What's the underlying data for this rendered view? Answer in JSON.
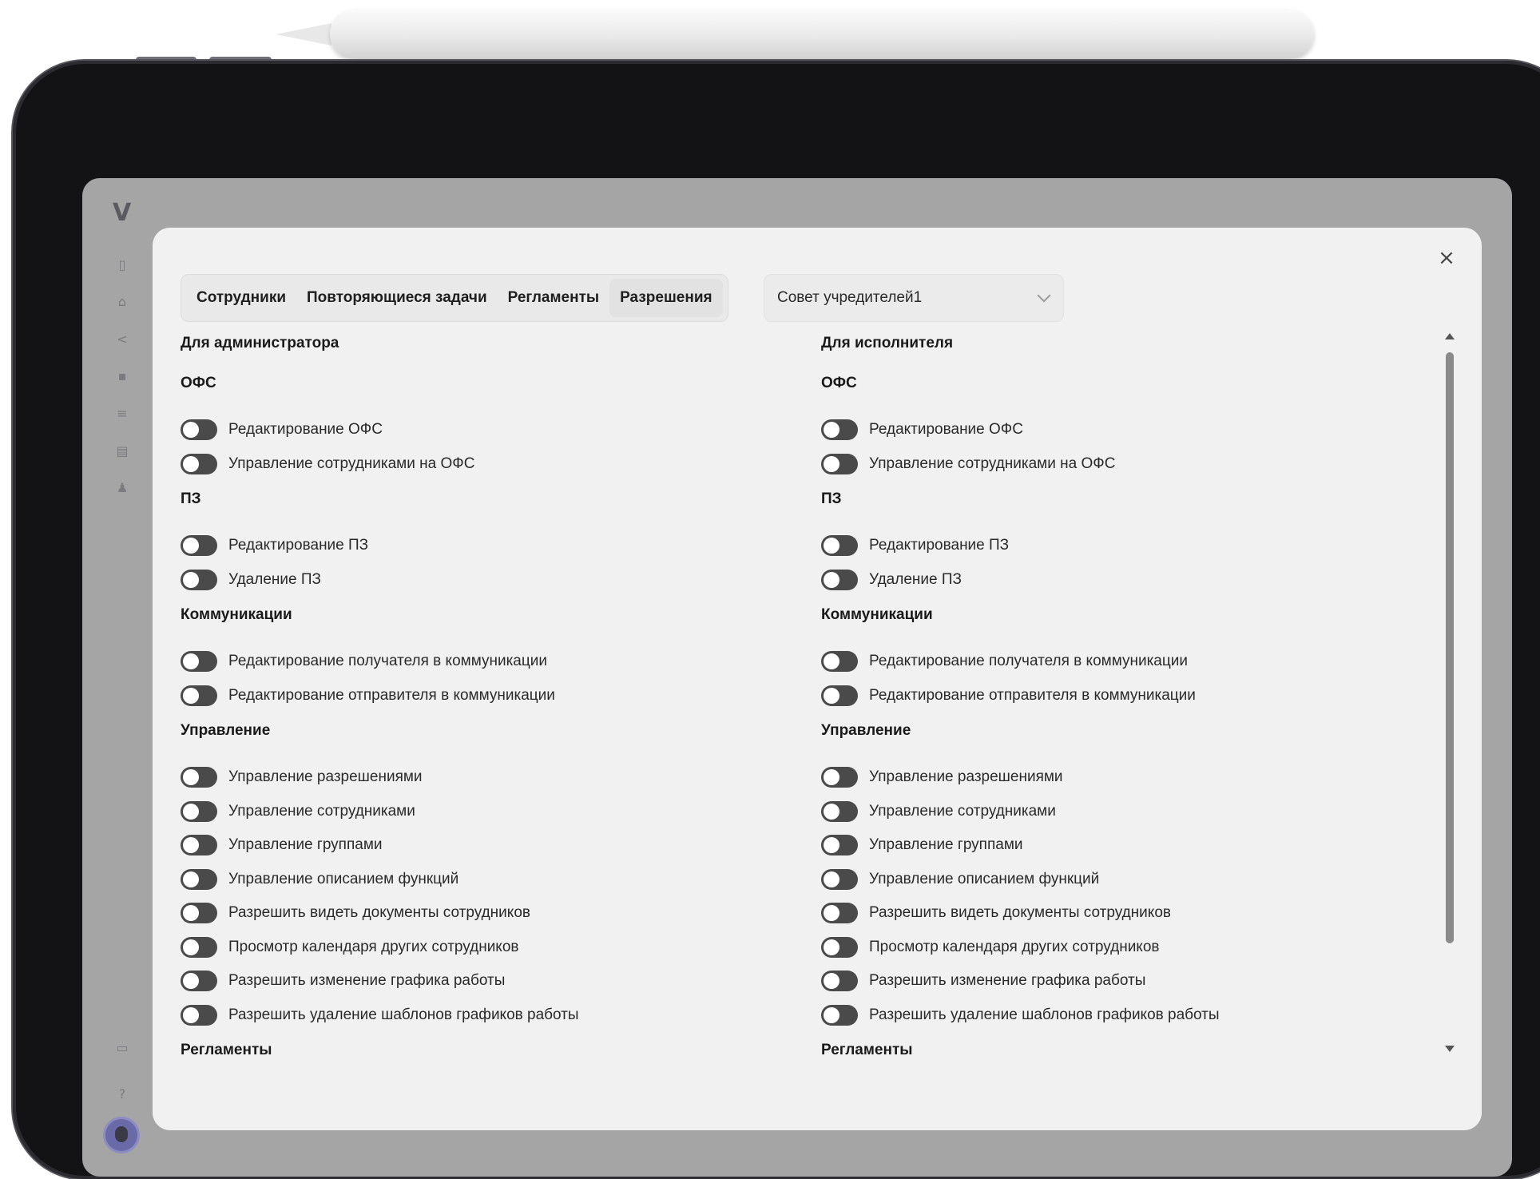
{
  "tabs": [
    {
      "label": "Сотрудники",
      "active": false
    },
    {
      "label": "Повторяющиеся задачи",
      "active": false
    },
    {
      "label": "Регламенты",
      "active": false
    },
    {
      "label": "Разрешения",
      "active": true
    }
  ],
  "group_select": {
    "value": "Совет учредителей1"
  },
  "close_symbol": "×",
  "sidebar": {
    "logo": "V",
    "icons": [
      "sidebar-panel-icon",
      "home-icon",
      "share-icon",
      "chat-icon",
      "list-icon",
      "documents-icon",
      "users-icon",
      "bag-icon",
      "help-icon"
    ]
  },
  "admin": {
    "title": "Для администратора",
    "sections": [
      {
        "title": "ОФС",
        "items": [
          "Редактирование ОФС",
          "Управление сотрудниками на ОФС"
        ]
      },
      {
        "title": "ПЗ",
        "items": [
          "Редактирование ПЗ",
          "Удаление ПЗ"
        ]
      },
      {
        "title": "Коммуникации",
        "items": [
          "Редактирование получателя в коммуникации",
          "Редактирование отправителя в коммуникации"
        ]
      },
      {
        "title": "Управление",
        "items": [
          "Управление разрешениями",
          "Управление сотрудниками",
          "Управление группами",
          "Управление описанием функций",
          "Разрешить видеть документы сотрудников",
          "Просмотр календаря других сотрудников",
          "Разрешить изменение графика работы",
          "Разрешить удаление шаблонов графиков работы"
        ]
      },
      {
        "title": "Регламенты",
        "items": []
      }
    ]
  },
  "executor": {
    "title": "Для исполнителя",
    "sections": [
      {
        "title": "ОФС",
        "items": [
          "Редактирование ОФС",
          "Управление сотрудниками на ОФС"
        ]
      },
      {
        "title": "ПЗ",
        "items": [
          "Редактирование ПЗ",
          "Удаление ПЗ"
        ]
      },
      {
        "title": "Коммуникации",
        "items": [
          "Редактирование получателя в коммуникации",
          "Редактирование отправителя в коммуникации"
        ]
      },
      {
        "title": "Управление",
        "items": [
          "Управление разрешениями",
          "Управление сотрудниками",
          "Управление группами",
          "Управление описанием функций",
          "Разрешить видеть документы сотрудников",
          "Просмотр календаря других сотрудников",
          "Разрешить изменение графика работы",
          "Разрешить удаление шаблонов графиков работы"
        ]
      },
      {
        "title": "Регламенты",
        "items": []
      }
    ]
  },
  "toggle_state": "off",
  "colors": {
    "toggle_off": "#4a4a4a",
    "modal_bg": "#f1f1f1",
    "overlay": "#a5a5a5"
  }
}
